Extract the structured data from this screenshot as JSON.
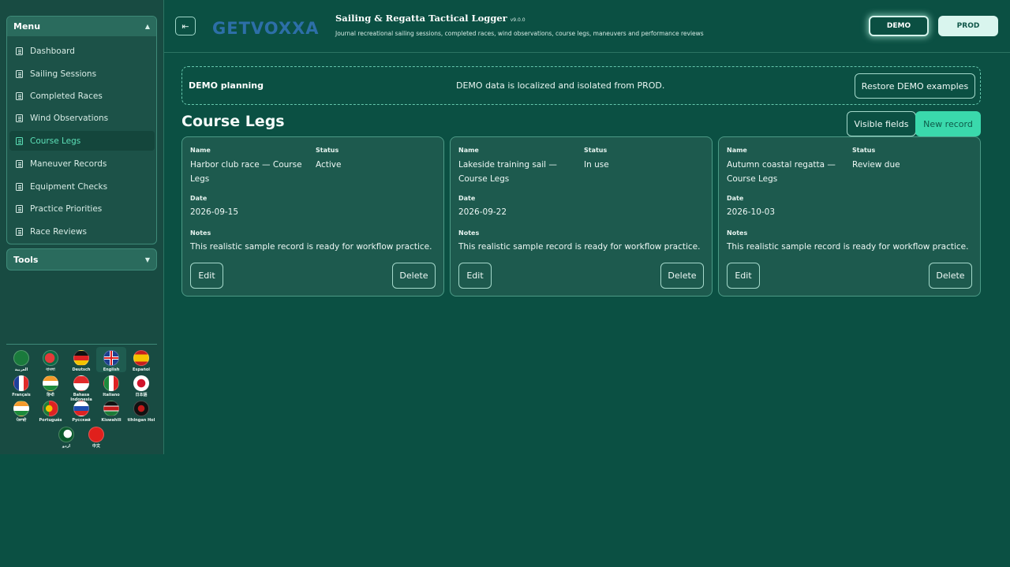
{
  "sidebar": {
    "menu_title": "Menu",
    "items": [
      {
        "label": "Dashboard"
      },
      {
        "label": "Sailing Sessions"
      },
      {
        "label": "Completed Races"
      },
      {
        "label": "Wind Observations"
      },
      {
        "label": "Course Legs"
      },
      {
        "label": "Maneuver Records"
      },
      {
        "label": "Equipment Checks"
      },
      {
        "label": "Practice Priorities"
      },
      {
        "label": "Race Reviews"
      }
    ],
    "active_item": "Course Legs",
    "tools_title": "Tools",
    "languages": [
      {
        "label": "العربية",
        "icon": "saudi-flag-icon"
      },
      {
        "label": "বাংলা",
        "icon": "bangladesh-flag-icon"
      },
      {
        "label": "Deutsch",
        "icon": "germany-flag-icon"
      },
      {
        "label": "English",
        "icon": "uk-flag-icon"
      },
      {
        "label": "Español",
        "icon": "spain-flag-icon"
      },
      {
        "label": "Français",
        "icon": "france-flag-icon"
      },
      {
        "label": "हिन्दी",
        "icon": "india-flag-icon"
      },
      {
        "label": "Bahasa Indonesia",
        "icon": "indonesia-flag-icon"
      },
      {
        "label": "Italiano",
        "icon": "italy-flag-icon"
      },
      {
        "label": "日本語",
        "icon": "japan-flag-icon"
      },
      {
        "label": "ਪੰਜਾਬੀ",
        "icon": "india-flag-icon"
      },
      {
        "label": "Português",
        "icon": "portugal-flag-icon"
      },
      {
        "label": "Русский",
        "icon": "russia-flag-icon"
      },
      {
        "label": "Kiswahili",
        "icon": "kenya-flag-icon"
      },
      {
        "label": "tlhIngan Hol",
        "icon": "klingon-flag-icon"
      },
      {
        "label": "اردو",
        "icon": "pakistan-flag-icon"
      },
      {
        "label": "中文",
        "icon": "china-flag-icon"
      }
    ],
    "selected_language": "English"
  },
  "header": {
    "logo_text": "GETVOXXA",
    "app_title": "Sailing & Regatta Tactical Logger",
    "version": "v9.0.0",
    "subtitle": "Journal recreational sailing sessions, completed races, wind observations, course legs, maneuvers and performance reviews",
    "demo_label": "DEMO",
    "prod_label": "PROD",
    "collapse_icon": "collapse-sidebar-icon"
  },
  "banner": {
    "title": "DEMO planning",
    "text": "DEMO data is localized and isolated from PROD.",
    "restore_label": "Restore DEMO examples"
  },
  "page": {
    "title": "Course Legs",
    "visible_fields_label": "Visible fields",
    "new_record_label": "New record"
  },
  "cards": [
    {
      "name_label": "Name",
      "name": "Harbor club race — Course Legs",
      "status_label": "Status",
      "status": "Active",
      "date_label": "Date",
      "date": "2026-09-15",
      "notes_label": "Notes",
      "notes": "This realistic sample record is ready for workflow practice.",
      "edit_label": "Edit",
      "delete_label": "Delete"
    },
    {
      "name_label": "Name",
      "name": "Lakeside training sail — Course Legs",
      "status_label": "Status",
      "status": "In use",
      "date_label": "Date",
      "date": "2026-09-22",
      "notes_label": "Notes",
      "notes": "This realistic sample record is ready for workflow practice.",
      "edit_label": "Edit",
      "delete_label": "Delete"
    },
    {
      "name_label": "Name",
      "name": "Autumn coastal regatta — Course Legs",
      "status_label": "Status",
      "status": "Review due",
      "date_label": "Date",
      "date": "2026-10-03",
      "notes_label": "Notes",
      "notes": "This realistic sample record is ready for workflow practice.",
      "edit_label": "Edit",
      "delete_label": "Delete"
    }
  ],
  "colors": {
    "background": "#0b5043",
    "sidebar": "#184b42",
    "accent": "#3ad9ac",
    "active_text": "#5de0b8"
  }
}
